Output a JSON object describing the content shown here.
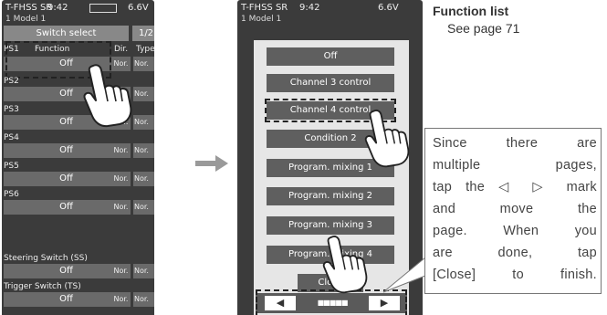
{
  "left_screen": {
    "status": {
      "title": "T-FHSS SR",
      "time": "9:42",
      "battery": "6.6V"
    },
    "model": "1   Model 1",
    "header": {
      "title": "Switch select",
      "page": "1/2"
    },
    "columns": {
      "switch": "PS1",
      "function": "Function",
      "dir": "Dir.",
      "type": "Type"
    },
    "rows": [
      {
        "label": "",
        "function": "Off",
        "dir": "Nor.",
        "type": "Nor."
      },
      {
        "label": "PS2",
        "function": "Off",
        "dir": "Nor.",
        "type": "Nor."
      },
      {
        "label": "PS3",
        "function": "Off",
        "dir": "Nor.",
        "type": "Nor."
      },
      {
        "label": "PS4",
        "function": "Off",
        "dir": "Nor.",
        "type": "Nor."
      },
      {
        "label": "PS5",
        "function": "Off",
        "dir": "Nor.",
        "type": "Nor."
      },
      {
        "label": "PS6",
        "function": "Off",
        "dir": "Nor.",
        "type": "Nor."
      },
      {
        "label": "Steering Switch (SS)",
        "function": "Off",
        "dir": "Nor.",
        "type": "Nor."
      },
      {
        "label": "Trigger Switch (TS)",
        "function": "Off",
        "dir": "Nor.",
        "type": "Nor."
      }
    ]
  },
  "right_screen": {
    "status": {
      "title": "T-FHSS SR",
      "time": "9:42",
      "battery": "6.6V"
    },
    "model": "1   Model 1",
    "options": [
      "Off",
      "Channel 3 control",
      "Channel 4 control",
      "Condition 2",
      "Program. mixing 1",
      "Program. mixing 2",
      "Program. mixing 3",
      "Program. mixing 4"
    ],
    "close_label": "Close",
    "page_indicator": "■■■■■",
    "prev_icon": "◀",
    "next_icon": "▶"
  },
  "notes": {
    "title": "Function list",
    "subtitle": "See page 71",
    "callout_lines": [
      "Since there are",
      "multiple pages,",
      "tap the ◁ ▷ mark",
      "and move the",
      "page. When you",
      "are done, tap",
      "[Close] to finish."
    ]
  },
  "colors": {
    "screen": "#3b3b3b",
    "bar": "#6a6a6a",
    "popup": "#e6e6e6",
    "option": "#5f5f5f",
    "arrow": "#9a9a9a"
  },
  "icons": [
    "hand-pointer-icon",
    "arrow-right-icon",
    "chevron-left-icon",
    "chevron-right-icon"
  ]
}
